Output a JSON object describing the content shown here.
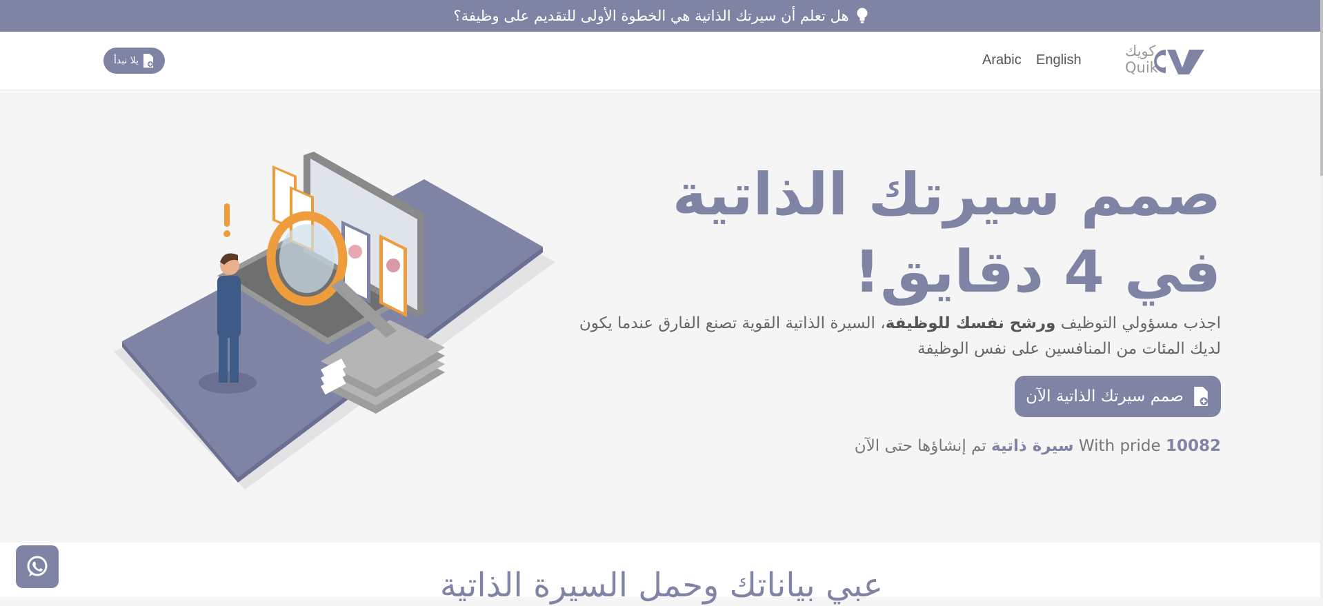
{
  "announcement": {
    "text": "هل تعلم أن سيرتك الذاتية هي الخطوة الأولى للتقديم على وظيفة؟",
    "icon": "lightbulb-icon"
  },
  "header": {
    "logo_text_ar": "كويك",
    "logo_text_en": "Quik",
    "logo_mark": "CV",
    "languages": [
      "Arabic",
      "English"
    ],
    "start_button_label": "يلا نبدأ"
  },
  "hero": {
    "title": "صمم سيرتك الذاتية في 4 دقايق!",
    "description_start": "اجذب مسؤولي التوظيف ",
    "description_bold": "ورشح نفسك للوظيفة",
    "description_end": "، السيرة الذاتية القوية تصنع الفارق عندما يكون لديك المئات من المنافسين على نفس الوظيفة",
    "cta_label": "صمم سيرتك الذاتية الآن",
    "counter_number": "10082",
    "counter_with_pride": "With pride",
    "counter_bold": "سيرة ذاتية",
    "counter_rest": "تم إنشاؤها حتى الآن"
  },
  "section2": {
    "title": "عبي بياناتك وحمل السيرة الذاتية"
  },
  "colors": {
    "accent": "#7f84a5",
    "background": "#f5f5f5",
    "orange": "#ef9d3c"
  }
}
